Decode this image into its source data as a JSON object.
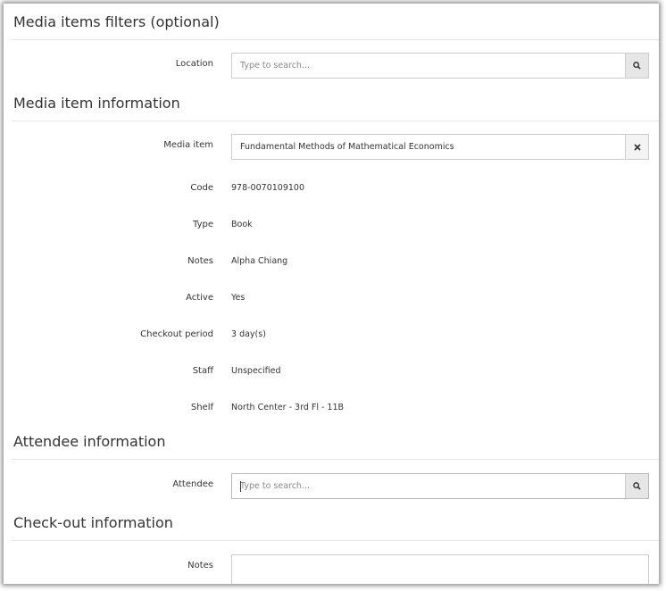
{
  "filters": {
    "title": "Media items filters (optional)",
    "location": {
      "label": "Location",
      "placeholder": "Type to search...",
      "button_icon": "search-icon"
    }
  },
  "media_info": {
    "title": "Media item information",
    "media_item": {
      "label": "Media item",
      "value": "Fundamental Methods of Mathematical Economics",
      "button_icon": "close-icon"
    },
    "fields": [
      {
        "label": "Code",
        "value": "978-0070109100"
      },
      {
        "label": "Type",
        "value": "Book"
      },
      {
        "label": "Notes",
        "value": "Alpha Chiang"
      },
      {
        "label": "Active",
        "value": "Yes"
      },
      {
        "label": "Checkout period",
        "value": "3 day(s)"
      },
      {
        "label": "Staff",
        "value": "Unspecified"
      },
      {
        "label": "Shelf",
        "value": "North Center - 3rd Fl - 11B"
      }
    ]
  },
  "attendee": {
    "title": "Attendee information",
    "attendee": {
      "label": "Attendee",
      "placeholder": "Type to search...",
      "button_icon": "search-icon"
    }
  },
  "checkout": {
    "title": "Check-out information",
    "notes": {
      "label": "Notes",
      "value": ""
    }
  }
}
